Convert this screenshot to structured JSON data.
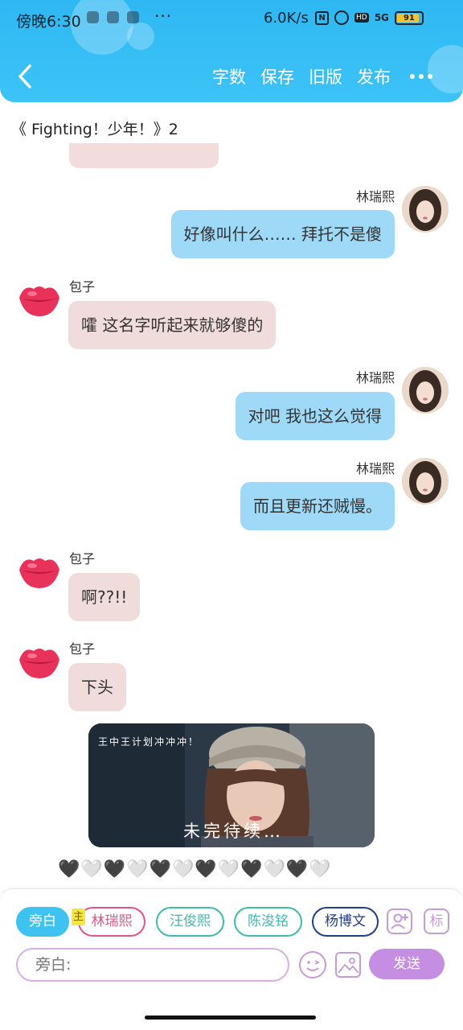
{
  "status_bar": {
    "time": "傍晚6:30",
    "more": "···",
    "network_speed": "6.0K/s",
    "nfc_icon": "N",
    "hd_icon": "HD",
    "signal_icon": "5G",
    "battery": "91",
    "battery_level": 0.91
  },
  "nav": {
    "back_icon": "chevron-left-icon",
    "actions": [
      "字数",
      "保存",
      "旧版",
      "发布"
    ],
    "more_icon": "more-horizontal-icon"
  },
  "chapter_title": "《 Fighting！少年！》2",
  "messages": [
    {
      "speaker": "林瑞熙",
      "text": "好像叫什么…… 拜托不是傻",
      "side": "right"
    },
    {
      "speaker": "包子",
      "text": "嚯 这名字听起来就够傻的",
      "side": "left"
    },
    {
      "speaker": "林瑞熙",
      "text": "对吧 我也这么觉得",
      "side": "right"
    },
    {
      "speaker": "林瑞熙",
      "text": "而且更新还贼慢。",
      "side": "right"
    },
    {
      "speaker": "包子",
      "text": "啊??!!",
      "side": "left"
    },
    {
      "speaker": "包子",
      "text": "下头",
      "side": "left"
    }
  ],
  "photo": {
    "caption_top": "王中王计划冲冲冲！",
    "caption_bottom": "未完待续…"
  },
  "hearts": "🖤🤍🖤🤍🖤🤍🖤🤍🖤🤍🖤🤍",
  "composer": {
    "chips": [
      "旁白",
      "林瑞熙",
      "汪俊熙",
      "陈浚铭",
      "杨博文"
    ],
    "main_badge": "主",
    "tag_icon": "标",
    "input_placeholder": "旁白:",
    "send_label": "发送"
  },
  "colors": {
    "header": "#2fb7f3",
    "right_bubble": "#9edaf7",
    "left_bubble": "#f1dcdc",
    "accent_purple": "#c58ee3"
  }
}
